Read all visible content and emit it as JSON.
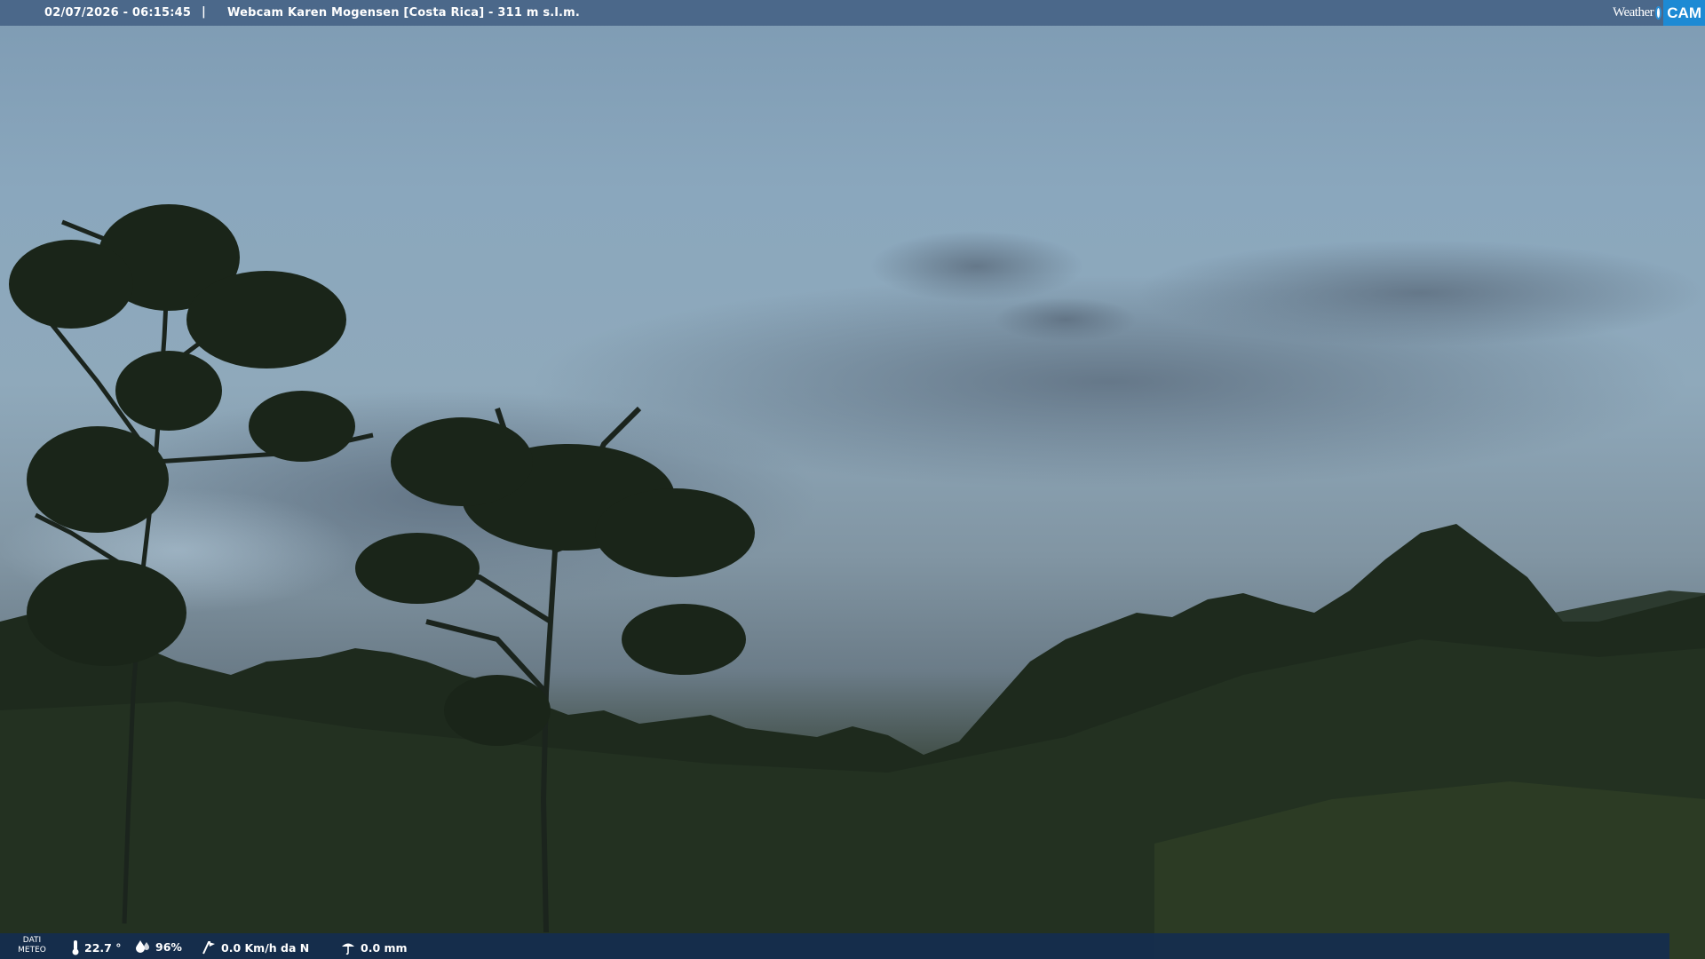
{
  "header": {
    "datetime": "02/07/2026 - 06:15:45",
    "separator": "|",
    "title": "Webcam Karen Mogensen [Costa Rica]  - 311 m s.l.m."
  },
  "logo": {
    "weather_text": "Weather",
    "cam_text": "CAM",
    "accent_color": "#1d8ad4"
  },
  "meteo": {
    "label_line1": "DATI",
    "label_line2": "METEO",
    "temperature": "22.7 °",
    "humidity": "96%",
    "wind": "0.0 Km/h da N",
    "rain": "0.0 mm",
    "icons": [
      "thermometer-icon",
      "humidity-icon",
      "wind-icon",
      "rain-icon"
    ]
  }
}
